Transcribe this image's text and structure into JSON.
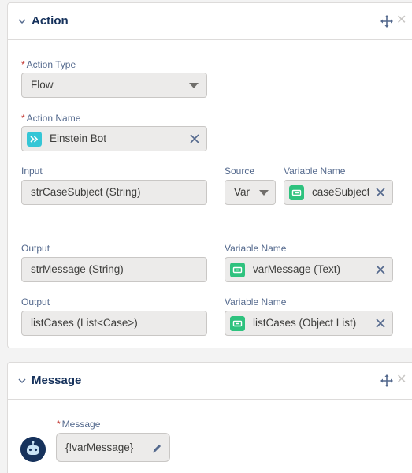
{
  "action_card": {
    "title": "Action",
    "action_type": {
      "label": "Action Type",
      "value": "Flow"
    },
    "action_name": {
      "label": "Action Name",
      "value": "Einstein Bot"
    },
    "input": {
      "label": "Input",
      "value": "strCaseSubject (String)",
      "source_label": "Source",
      "source_value": "Var",
      "variable_label": "Variable Name",
      "variable_value": "caseSubject"
    },
    "outputs": [
      {
        "label": "Output",
        "value": "strMessage (String)",
        "variable_label": "Variable Name",
        "variable_value": "varMessage (Text)"
      },
      {
        "label": "Output",
        "value": "listCases (List<Case>)",
        "variable_label": "Variable Name",
        "variable_value": "listCases (Object List)"
      }
    ]
  },
  "message_card": {
    "title": "Message",
    "message_label": "Message",
    "message_value": "{!varMessage}"
  },
  "colors": {
    "title": "#16325c",
    "einstein_icon": "#35c6d6",
    "variable_icon": "#2ec27e",
    "required": "#c23934"
  }
}
